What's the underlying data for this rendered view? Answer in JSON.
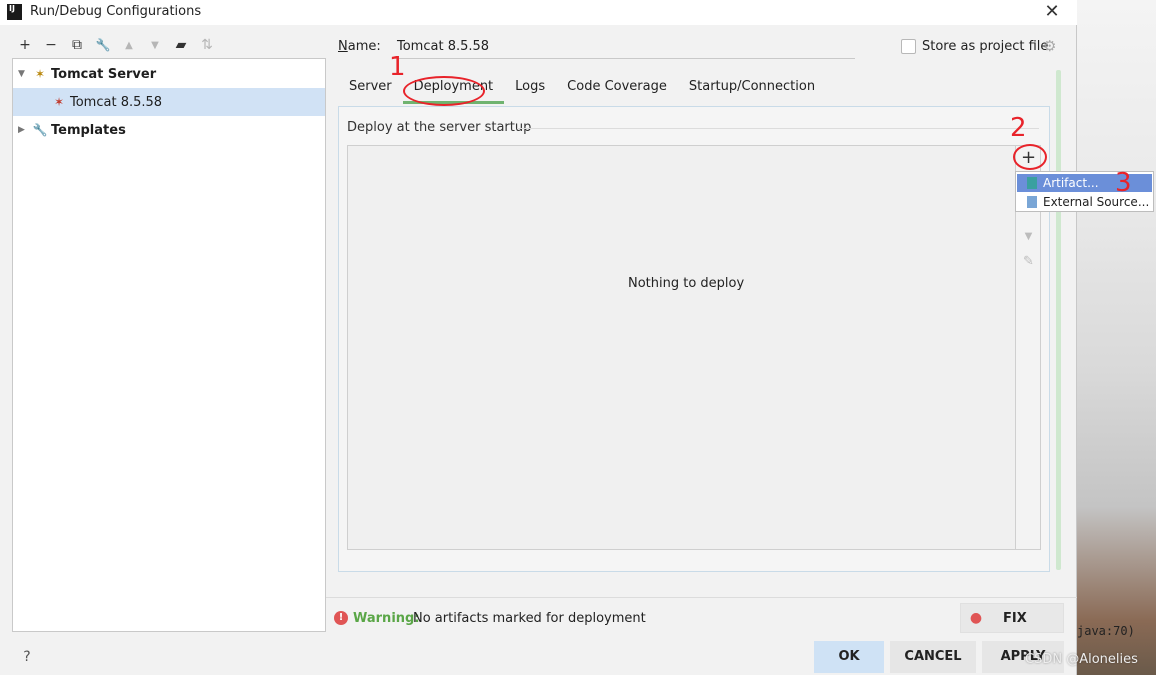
{
  "window": {
    "title": "Run/Debug Configurations",
    "app_icon": "IJ"
  },
  "toolbar": [
    {
      "icon": "plus-icon",
      "glyph": "+"
    },
    {
      "icon": "minus-icon",
      "glyph": "−"
    },
    {
      "icon": "copy-icon",
      "glyph": "⧉"
    },
    {
      "icon": "wrench-icon",
      "glyph": "🔧"
    },
    {
      "icon": "arrow-up-icon",
      "glyph": "▲"
    },
    {
      "icon": "arrow-down-icon",
      "glyph": "▼"
    },
    {
      "icon": "folder-icon",
      "glyph": "▰"
    },
    {
      "icon": "sort-icon",
      "glyph": "⇅"
    }
  ],
  "tree": {
    "group": "Tomcat Server",
    "item": "Tomcat 8.5.58",
    "templates": "Templates"
  },
  "config": {
    "name_label_prefix": "N",
    "name_label_rest": "ame:",
    "name_value": "Tomcat 8.5.58",
    "store_label": "Store as project file"
  },
  "tabs": [
    "Server",
    "Deployment",
    "Logs",
    "Code Coverage",
    "Startup/Connection"
  ],
  "deploy": {
    "section_title": "Deploy at the server startup",
    "empty_message": "Nothing to deploy"
  },
  "popup": {
    "items": [
      "Artifact...",
      "External Source..."
    ]
  },
  "warning": {
    "label": "Warning:",
    "text": "No artifacts marked for deployment"
  },
  "buttons": {
    "fix": "FIX",
    "help": "?",
    "ok": "OK",
    "cancel": "CANCEL",
    "apply": "APPLY"
  },
  "background": {
    "code_text": "java:70)",
    "watermark": "CSDN @Alonelies"
  },
  "annotations": [
    "1",
    "2",
    "3"
  ],
  "colors": {
    "selection": "#d1e2f5",
    "popup_highlight": "#6b8fd9",
    "warning_green": "#5aa647",
    "annotation_red": "#e8232a"
  }
}
